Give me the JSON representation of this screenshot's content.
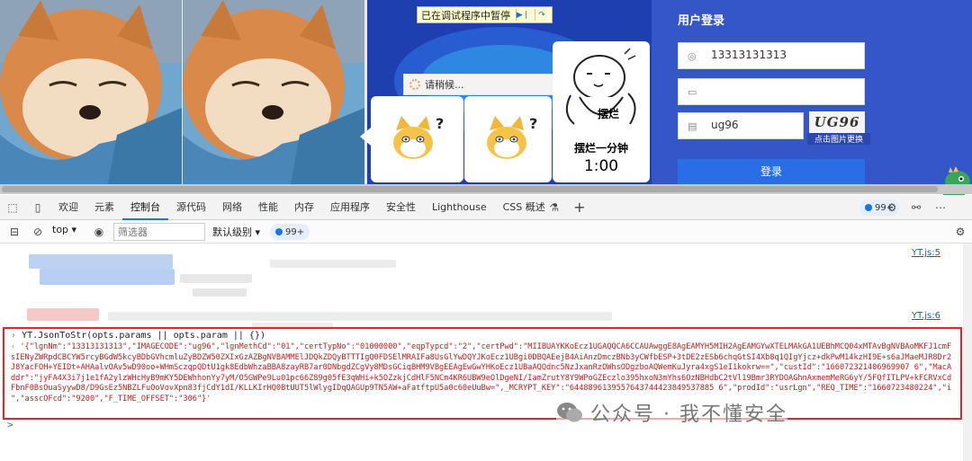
{
  "page": {
    "paused_banner": "已在调试程序中暂停",
    "loading_text": "请稍候...",
    "meme_word": "摆烂",
    "meme_caption": "摆烂一分钟",
    "meme_timer": "1:00",
    "login": {
      "title": "用户登录",
      "username": "13313131313",
      "captcha_value": "ug96",
      "captcha_image_text": "UG96",
      "captcha_hint": "点击图片更换",
      "submit_label": "登录"
    }
  },
  "devtools": {
    "tabs": [
      "欢迎",
      "元素",
      "控制台",
      "源代码",
      "网络",
      "性能",
      "内存",
      "应用程序",
      "安全性",
      "Lighthouse",
      "CSS 概述"
    ],
    "active_tab": "控制台",
    "issues_count": "99+",
    "context": "top",
    "filter_placeholder": "筛选器",
    "level": "默认级别",
    "issues_count2": "99+"
  },
  "console": {
    "src1": "YT.js:5",
    "src2": "YT.js:6",
    "command": "YT.JsonToStr(opts.params || opts.param || {})",
    "result": "'{\"lgnNm\":\"13313131313\",\"IMAGECODE\":\"ug96\",\"lgnMethCd\":\"01\",\"certTypNo\":\"01000000\",\"eqpTypcd\":\"2\",\"certPwd\":\"MIIBUAYKKoEcz1UGAQQCA6CCAUAwggE8AgEAMYH5MIH2AgEAMGYwXTELMAkGA1UEBhMCQ04xMTAvBgNVBAoMKFJ1cmFsIENyZWRpdCBCYW5rcyBGdW5kcyBDbGVhcmluZyBDZW50ZXIxGzAZBgNVBAMMElJDQkZDQyBTTTIgQ0FDSElMRAIFa8UsGlYwDQYJKoEcz1UBgi0DBQAEejB4AiAnzDmczBNb3yCWfbESP+3tDE2zESb6chqGtSI4Xb8q1QIgYjcz+dkPwM14kzHI9E+s6aJMaeMJR8Dr2J8YacFOH+YEIDt+AHAalvOAv5wD90oo+WHmSczqpQDtU1gk8EdbWhzaBBA8zayRB7ar0DNbgdZCgVy8MDsGCiqBHM9VBgEEAgEwGwYHKoEcz1UBaAQQdnc5NzJxanRzOWhsODgzboAQWemKuJyra4xgS1eI1kokrw==\",\"custId\":\"166072321406969907 6\",\"MacAddr\":\"jyFA4X3i7j1e1fA2ylzWHcHyB9mKY5DEWhhonYy7yM/O5GWPe9Lu01pc66Z89g05fE3qWHi+k5OZzkjCdHlF5NCm4KR6UBW9eOlDgeNI/IamZrutY8Y9WPoGZEczlo395hxoN3mYhs6OzNBHdbC2tVl19Bmr3RYDOAGhnAxmemMeRG6yY/5FQfITLPV+kFCRVxCdFbnF0BsOuaSyywD8/D9GsEz5NBZLFuOoVovXpn83fjCdY1dI/KLLKIrHQ0BtUUT5lWlygIDqQAGUp9TN5AW+aFatftpU5a0c60eUuBw=\",_MCRYPT_KEY\":\"6448896139557643744423849537885 6\",\"prodId\":\"usrLgn\",\"REQ_TIME\":\"1660723480224\",\"i  \",\"asscOFcd\":\"9200\",\"F_TIME_OFFSET\":\"306\"}'",
    "input_prompt": ">"
  },
  "watermark": "公众号 · 我不懂安全",
  "colors": {
    "accent": "#1a73e8",
    "highlight_border": "#ee2222",
    "string": "#c21c1c"
  }
}
